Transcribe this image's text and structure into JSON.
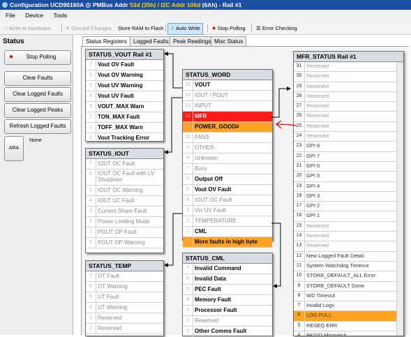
{
  "window": {
    "title_prefix": "Configuration UCD90160A @ PMBus Addr ",
    "addr_hl": "53d (35h) / I2C Addr 106d",
    "title_suffix": " (6Ah) - Rail #1"
  },
  "menu": [
    "File",
    "Device",
    "Tools"
  ],
  "toolbar": {
    "write": "Write to Hardware",
    "discard": "Discard Changes",
    "store": "Store RAM to Flash",
    "auto": "Auto Write",
    "stop": "Stop Polling",
    "err": "Error Checking"
  },
  "left": {
    "header": "Status",
    "stop_polling": "Stop Polling",
    "clear_faults": "Clear Faults",
    "clear_logged_faults": "Clear Logged Faults",
    "clear_logged_peaks": "Clear Logged Peaks",
    "refresh_logged_faults": "Refresh Logged Faults",
    "ara": "ARA",
    "ara_value": "None"
  },
  "tabs": [
    "Status Registers",
    "Logged Faults",
    "Peak Readings",
    "Misc Status"
  ],
  "vout": {
    "title": "STATUS_VOUT Rail #1",
    "rows": [
      {
        "n": "7",
        "t": "Vout OV Fault"
      },
      {
        "n": "6",
        "t": "Vout OV Warning"
      },
      {
        "n": "5",
        "t": "Vout UV Warning"
      },
      {
        "n": "4",
        "t": "Vout UV Fault"
      },
      {
        "n": "3",
        "t": "VOUT_MAX Warn"
      },
      {
        "n": "2",
        "t": "TON_MAX Fault"
      },
      {
        "n": "1",
        "t": "TOFF_MAX Warn"
      },
      {
        "n": "0",
        "t": "Vout Tracking Error"
      }
    ]
  },
  "iout": {
    "title": "STATUS_IOUT",
    "rows": [
      {
        "n": "7",
        "t": "IOUT OC Fault"
      },
      {
        "n": "6",
        "t": "IOUT OC Fault with LV Shutdown"
      },
      {
        "n": "5",
        "t": "IOUT OC Warning"
      },
      {
        "n": "4",
        "t": "IOUT UC Fault"
      },
      {
        "n": "3",
        "t": "Current Share Fault"
      },
      {
        "n": "2",
        "t": "Power Limiting Mode"
      },
      {
        "n": "1",
        "t": "POUT OP Fault"
      },
      {
        "n": "0",
        "t": "POUT OP Warning"
      }
    ]
  },
  "temp": {
    "title": "STATUS_TEMP",
    "rows": [
      {
        "n": "7",
        "t": "OT Fault"
      },
      {
        "n": "6",
        "t": "OT Warning"
      },
      {
        "n": "5",
        "t": "UT Fault"
      },
      {
        "n": "4",
        "t": "UT Warning"
      },
      {
        "n": "3",
        "t": "Reserved"
      },
      {
        "n": "2",
        "t": "Reserved"
      }
    ]
  },
  "word": {
    "title": "STATUS_WORD",
    "rows": [
      {
        "n": "15",
        "t": "VOUT"
      },
      {
        "n": "14",
        "t": "IOUT / POUT"
      },
      {
        "n": "13",
        "t": "INPUT"
      },
      {
        "n": "12",
        "t": "MFR"
      },
      {
        "n": "11",
        "t": "POWER_GOOD#"
      },
      {
        "n": "10",
        "t": "FANS"
      },
      {
        "n": "9",
        "t": "OTHER"
      },
      {
        "n": "8",
        "t": "Unknown"
      },
      {
        "n": "7",
        "t": "Busy"
      },
      {
        "n": "6",
        "t": "Output Off"
      },
      {
        "n": "5",
        "t": "Vout OV Fault"
      },
      {
        "n": "4",
        "t": "IOUT OC Fault"
      },
      {
        "n": "3",
        "t": "Vin UV Fault"
      },
      {
        "n": "2",
        "t": "TEMPERATURE"
      },
      {
        "n": "1",
        "t": "CML"
      },
      {
        "n": "0",
        "t": "More faults in high byte"
      }
    ]
  },
  "cml": {
    "title": "STATUS_CML",
    "rows": [
      {
        "n": "7",
        "t": "Invalid Command"
      },
      {
        "n": "6",
        "t": "Invalid Data"
      },
      {
        "n": "5",
        "t": "PEC Fault"
      },
      {
        "n": "4",
        "t": "Memory Fault"
      },
      {
        "n": "3",
        "t": "Processor Fault"
      },
      {
        "n": "2",
        "t": "Reserved"
      },
      {
        "n": "1",
        "t": "Other Comms Fault"
      }
    ]
  },
  "mfr": {
    "title": "MFR_STATUS Rail #1",
    "rows": [
      {
        "n": "31",
        "t": "Reserved"
      },
      {
        "n": "30",
        "t": "Reserved"
      },
      {
        "n": "29",
        "t": "Reserved"
      },
      {
        "n": "28",
        "t": "Reserved"
      },
      {
        "n": "27",
        "t": "Reserved"
      },
      {
        "n": "26",
        "t": "Reserved"
      },
      {
        "n": "25",
        "t": "Reserved"
      },
      {
        "n": "24",
        "t": "Reserved"
      },
      {
        "n": "23",
        "t": "GPI 8"
      },
      {
        "n": "22",
        "t": "GPI 7"
      },
      {
        "n": "21",
        "t": "GPI 6"
      },
      {
        "n": "20",
        "t": "GPI 5"
      },
      {
        "n": "19",
        "t": "GPI 4"
      },
      {
        "n": "18",
        "t": "GPI 3"
      },
      {
        "n": "17",
        "t": "GPI 2"
      },
      {
        "n": "16",
        "t": "GPI 1"
      },
      {
        "n": "15",
        "t": "Reserved"
      },
      {
        "n": "14",
        "t": "Reserved"
      },
      {
        "n": "13",
        "t": "Reserved"
      },
      {
        "n": "12",
        "t": "New Logged Fault Detail"
      },
      {
        "n": "11",
        "t": "System Watchdog Timeout"
      },
      {
        "n": "10",
        "t": "STORE_DEFAULT_ALL Error"
      },
      {
        "n": "9",
        "t": "STORE_DEFAULT Done"
      },
      {
        "n": "8",
        "t": "WD Timeout"
      },
      {
        "n": "7",
        "t": "Invalid Logs"
      },
      {
        "n": "6",
        "t": "LOG FULL"
      },
      {
        "n": "5",
        "t": "RESEQ ERR"
      },
      {
        "n": "4",
        "t": "PKGID Mismatch"
      }
    ]
  },
  "colors": {
    "active_red": "#ff1a1a",
    "active_orange": "#ffa321",
    "annotation_red": "#e00000"
  }
}
